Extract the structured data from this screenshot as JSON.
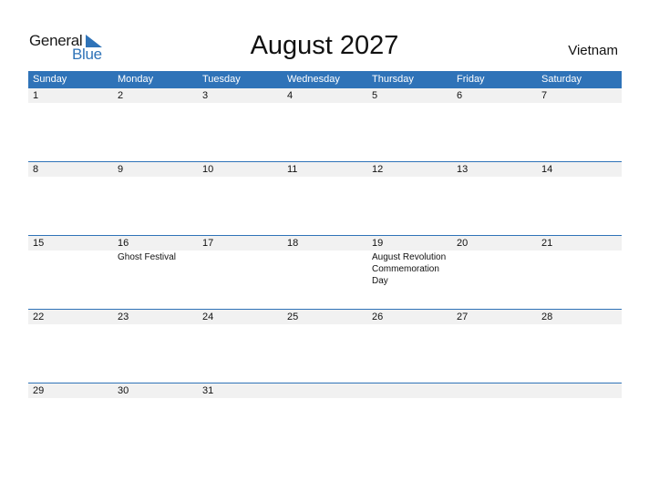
{
  "logo": {
    "part1": "General",
    "part2": "Blue"
  },
  "title": "August 2027",
  "country": "Vietnam",
  "weekdays": [
    "Sunday",
    "Monday",
    "Tuesday",
    "Wednesday",
    "Thursday",
    "Friday",
    "Saturday"
  ],
  "weeks": [
    {
      "days": [
        "1",
        "2",
        "3",
        "4",
        "5",
        "6",
        "7"
      ],
      "events": [
        "",
        "",
        "",
        "",
        "",
        "",
        ""
      ]
    },
    {
      "days": [
        "8",
        "9",
        "10",
        "11",
        "12",
        "13",
        "14"
      ],
      "events": [
        "",
        "",
        "",
        "",
        "",
        "",
        ""
      ]
    },
    {
      "days": [
        "15",
        "16",
        "17",
        "18",
        "19",
        "20",
        "21"
      ],
      "events": [
        "",
        "Ghost Festival",
        "",
        "",
        "August Revolution Commemoration Day",
        "",
        ""
      ]
    },
    {
      "days": [
        "22",
        "23",
        "24",
        "25",
        "26",
        "27",
        "28"
      ],
      "events": [
        "",
        "",
        "",
        "",
        "",
        "",
        ""
      ]
    },
    {
      "days": [
        "29",
        "30",
        "31",
        "",
        "",
        "",
        ""
      ],
      "events": [
        "",
        "",
        "",
        "",
        "",
        "",
        ""
      ]
    }
  ],
  "colors": {
    "accent": "#2f73b8",
    "date_bar": "#f1f1f1"
  }
}
